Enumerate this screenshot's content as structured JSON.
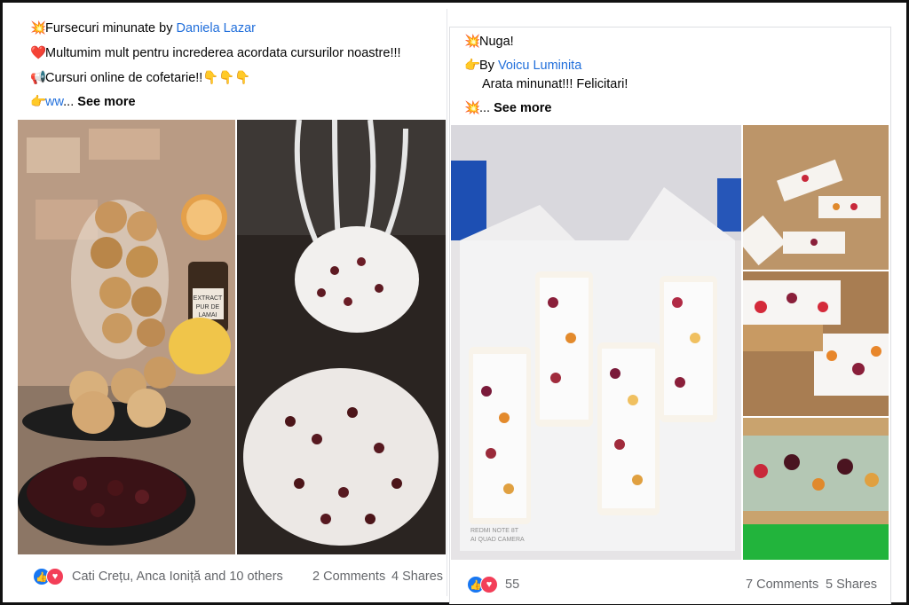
{
  "left_post": {
    "line1": {
      "emoji": "💥",
      "text": "Fursecuri minunate by ",
      "author": "Daniela Lazar"
    },
    "line2": {
      "emoji": "❤️",
      "text": "Multumim mult pentru increderea acordata cursurilor noastre!!!"
    },
    "line3": {
      "emoji": "📢",
      "text": "Cursuri online de cofetarie!!",
      "trail": "👇👇👇"
    },
    "line4": {
      "emoji": "👉",
      "link": "ww",
      "ellipsis": "... ",
      "see_more": "See more"
    },
    "photos": [
      {
        "icon": "cookies-jar-photo",
        "extract_label": "EXTRACT PUR DE LAMAI"
      },
      {
        "icon": "whisk-cranberries-photo"
      }
    ],
    "footer": {
      "reactions_text": "Cati Crețu, Anca Ioniță and 10 others",
      "comments": "2 Comments",
      "shares": "4 Shares"
    }
  },
  "right_post": {
    "line1": {
      "emoji": "💥",
      "text": "Nuga!"
    },
    "line2": {
      "emoji": "👉",
      "text": "By ",
      "author": "Voicu Luminita"
    },
    "line3": {
      "text": "Arata minunat!!! Felicitari!"
    },
    "line4": {
      "emoji": "💥",
      "ellipsis": "... ",
      "see_more": "See more"
    },
    "photos": [
      {
        "icon": "nougat-box-photo",
        "watermark_line1": "REDMI NOTE 8T",
        "watermark_line2": "AI QUAD CAMERA"
      },
      {
        "icon": "nougat-slices-photo"
      },
      {
        "icon": "nougat-closeup-photo"
      },
      {
        "icon": "nougat-wafer-photo"
      }
    ],
    "footer": {
      "reactions_count": "55",
      "comments": "7 Comments",
      "shares": "5 Shares"
    }
  },
  "colors": {
    "link": "#216fdb",
    "like": "#1877f2",
    "love": "#f33e58",
    "meta": "#65676b"
  }
}
